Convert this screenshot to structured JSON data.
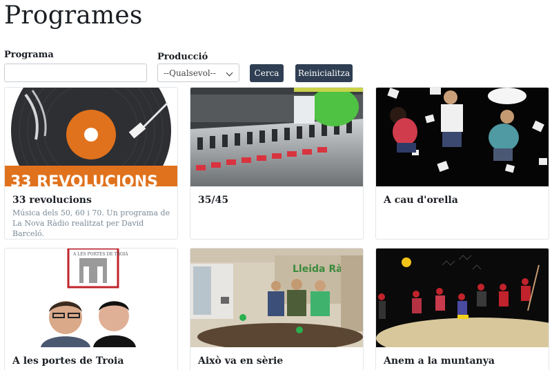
{
  "page": {
    "title": "Programes"
  },
  "filters": {
    "programa_label": "Programa",
    "programa_value": "",
    "produccio_label": "Producció",
    "produccio_selected": "--Qualsevol--",
    "search_label": "Cerca",
    "reset_label": "Reinicialitza"
  },
  "programs": [
    {
      "title": "33 revolucions",
      "description": "Música dels 50, 60 i 70. Un programa de La Nova Ràdio realitzat per David Barceló.",
      "image_text": "33 REVOLUCIONS"
    },
    {
      "title": "35/45",
      "description": ""
    },
    {
      "title": "A cau d'orella",
      "description": ""
    },
    {
      "title": "A les portes de Troia",
      "description": "",
      "image_text": "A LES PORTES DE TROIA"
    },
    {
      "title": "Això va en sèrie",
      "description": "",
      "image_text": "Lleida Ràdio"
    },
    {
      "title": "Anem a la muntanya",
      "description": ""
    }
  ],
  "colors": {
    "button_bg": "#2f3e52",
    "accent_orange": "#e0721d"
  }
}
